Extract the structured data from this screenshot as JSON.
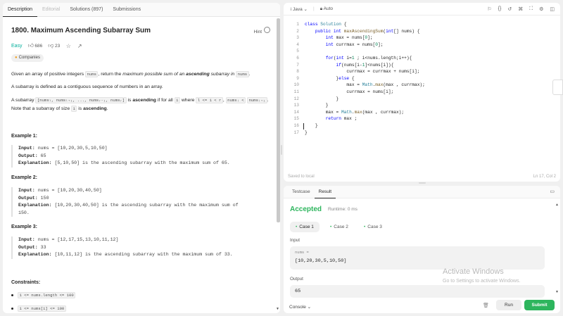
{
  "left_tabs": [
    "Description",
    "Editorial",
    "Solutions (897)",
    "Submissions"
  ],
  "problem": {
    "title": "1800. Maximum Ascending Subarray Sum",
    "hint": "Hint",
    "difficulty": "Easy",
    "likes": "686",
    "dislikes": "23",
    "companies": "Companies",
    "p1_a": "Given an array of positive integers ",
    "p1_code": "nums",
    "p1_b": ", return the ",
    "p1_c": "maximum possible sum of an ",
    "p1_d": "ascending",
    "p1_e": " subarray in ",
    "p1_code2": "nums",
    "p1_f": ".",
    "p2": "A subarray is defined as a contiguous sequence of numbers in an array.",
    "p3_a": "A subarray ",
    "p3_code1": "[numsₗ, numsₗ₊₁, ..., numsᵣ₋₁, numsᵣ]",
    "p3_b": " is ",
    "p3_c": "ascending",
    "p3_d": " if for all ",
    "p3_code2": "i",
    "p3_e": " where ",
    "p3_code3": "l <= i < r",
    "p3_f": ", ",
    "p3_code4": "numsᵢ <",
    "p3_code5": "numsᵢ₊₁",
    "p3_g": ". Note that a subarray of size ",
    "p3_code6": "1",
    "p3_h": " is ",
    "p3_i": "ascending",
    "p3_j": "."
  },
  "examples": [
    {
      "heading": "Example 1:",
      "input_label": "Input:",
      "input": "nums = [10,20,30,5,10,50]",
      "output_label": "Output:",
      "output": "65",
      "expl_label": "Explanation:",
      "expl": "[5,10,50] is the ascending subarray with the maximum sum of 65."
    },
    {
      "heading": "Example 2:",
      "input_label": "Input:",
      "input": "nums = [10,20,30,40,50]",
      "output_label": "Output:",
      "output": "150",
      "expl_label": "Explanation:",
      "expl": "[10,20,30,40,50] is the ascending subarray with the maximum sum of",
      "expl2": "150."
    },
    {
      "heading": "Example 3:",
      "input_label": "Input:",
      "input": "nums = [12,17,15,13,10,11,12]",
      "output_label": "Output:",
      "output": "33",
      "expl_label": "Explanation:",
      "expl": "[10,11,12] is the ascending subarray with the maximum sum of 33."
    }
  ],
  "constraints": {
    "heading": "Constraints:",
    "items": [
      "1 <= nums.length <= 100",
      "1 <= nums[i] <= 100"
    ]
  },
  "editor": {
    "language": "Java",
    "mode": "Auto",
    "saved": "Saved to local",
    "position": "Ln 17, Col 2",
    "lines": [
      {
        "n": "1",
        "t": "class Solution {"
      },
      {
        "n": "2",
        "t": "    public int maxAscendingSum(int[] nums) {"
      },
      {
        "n": "3",
        "t": "        int max = nums[0];"
      },
      {
        "n": "4",
        "t": "        int currmax = nums[0];"
      },
      {
        "n": "5",
        "t": ""
      },
      {
        "n": "6",
        "t": "        for(int i=1 ; i<nums.length;i++){"
      },
      {
        "n": "7",
        "t": "            if(nums[i-1]<nums[i]){"
      },
      {
        "n": "8",
        "t": "                currmax = currmax + nums[i];"
      },
      {
        "n": "9",
        "t": "            }else {"
      },
      {
        "n": "10",
        "t": "                max = Math.max(max , currmax);"
      },
      {
        "n": "11",
        "t": "                currmax = nums[i];"
      },
      {
        "n": "12",
        "t": "            }"
      },
      {
        "n": "13",
        "t": "        }"
      },
      {
        "n": "14",
        "t": "        max = Math.max(max , currmax);"
      },
      {
        "n": "15",
        "t": "        return max ;"
      },
      {
        "n": "16",
        "t": "    }"
      },
      {
        "n": "17",
        "t": "}"
      }
    ]
  },
  "result": {
    "tabs": [
      "Testcase",
      "Result"
    ],
    "status": "Accepted",
    "runtime": "Runtime: 0 ms",
    "cases": [
      "Case 1",
      "Case 2",
      "Case 3"
    ],
    "input_label": "Input",
    "var_name": "nums =",
    "input_value": "[10,20,30,5,10,50]",
    "output_label": "Output",
    "output_value": "65",
    "console": "Console",
    "run": "Run",
    "submit": "Submit"
  },
  "watermark": {
    "line1": "Activate Windows",
    "line2": "Go to Settings to activate Windows."
  }
}
